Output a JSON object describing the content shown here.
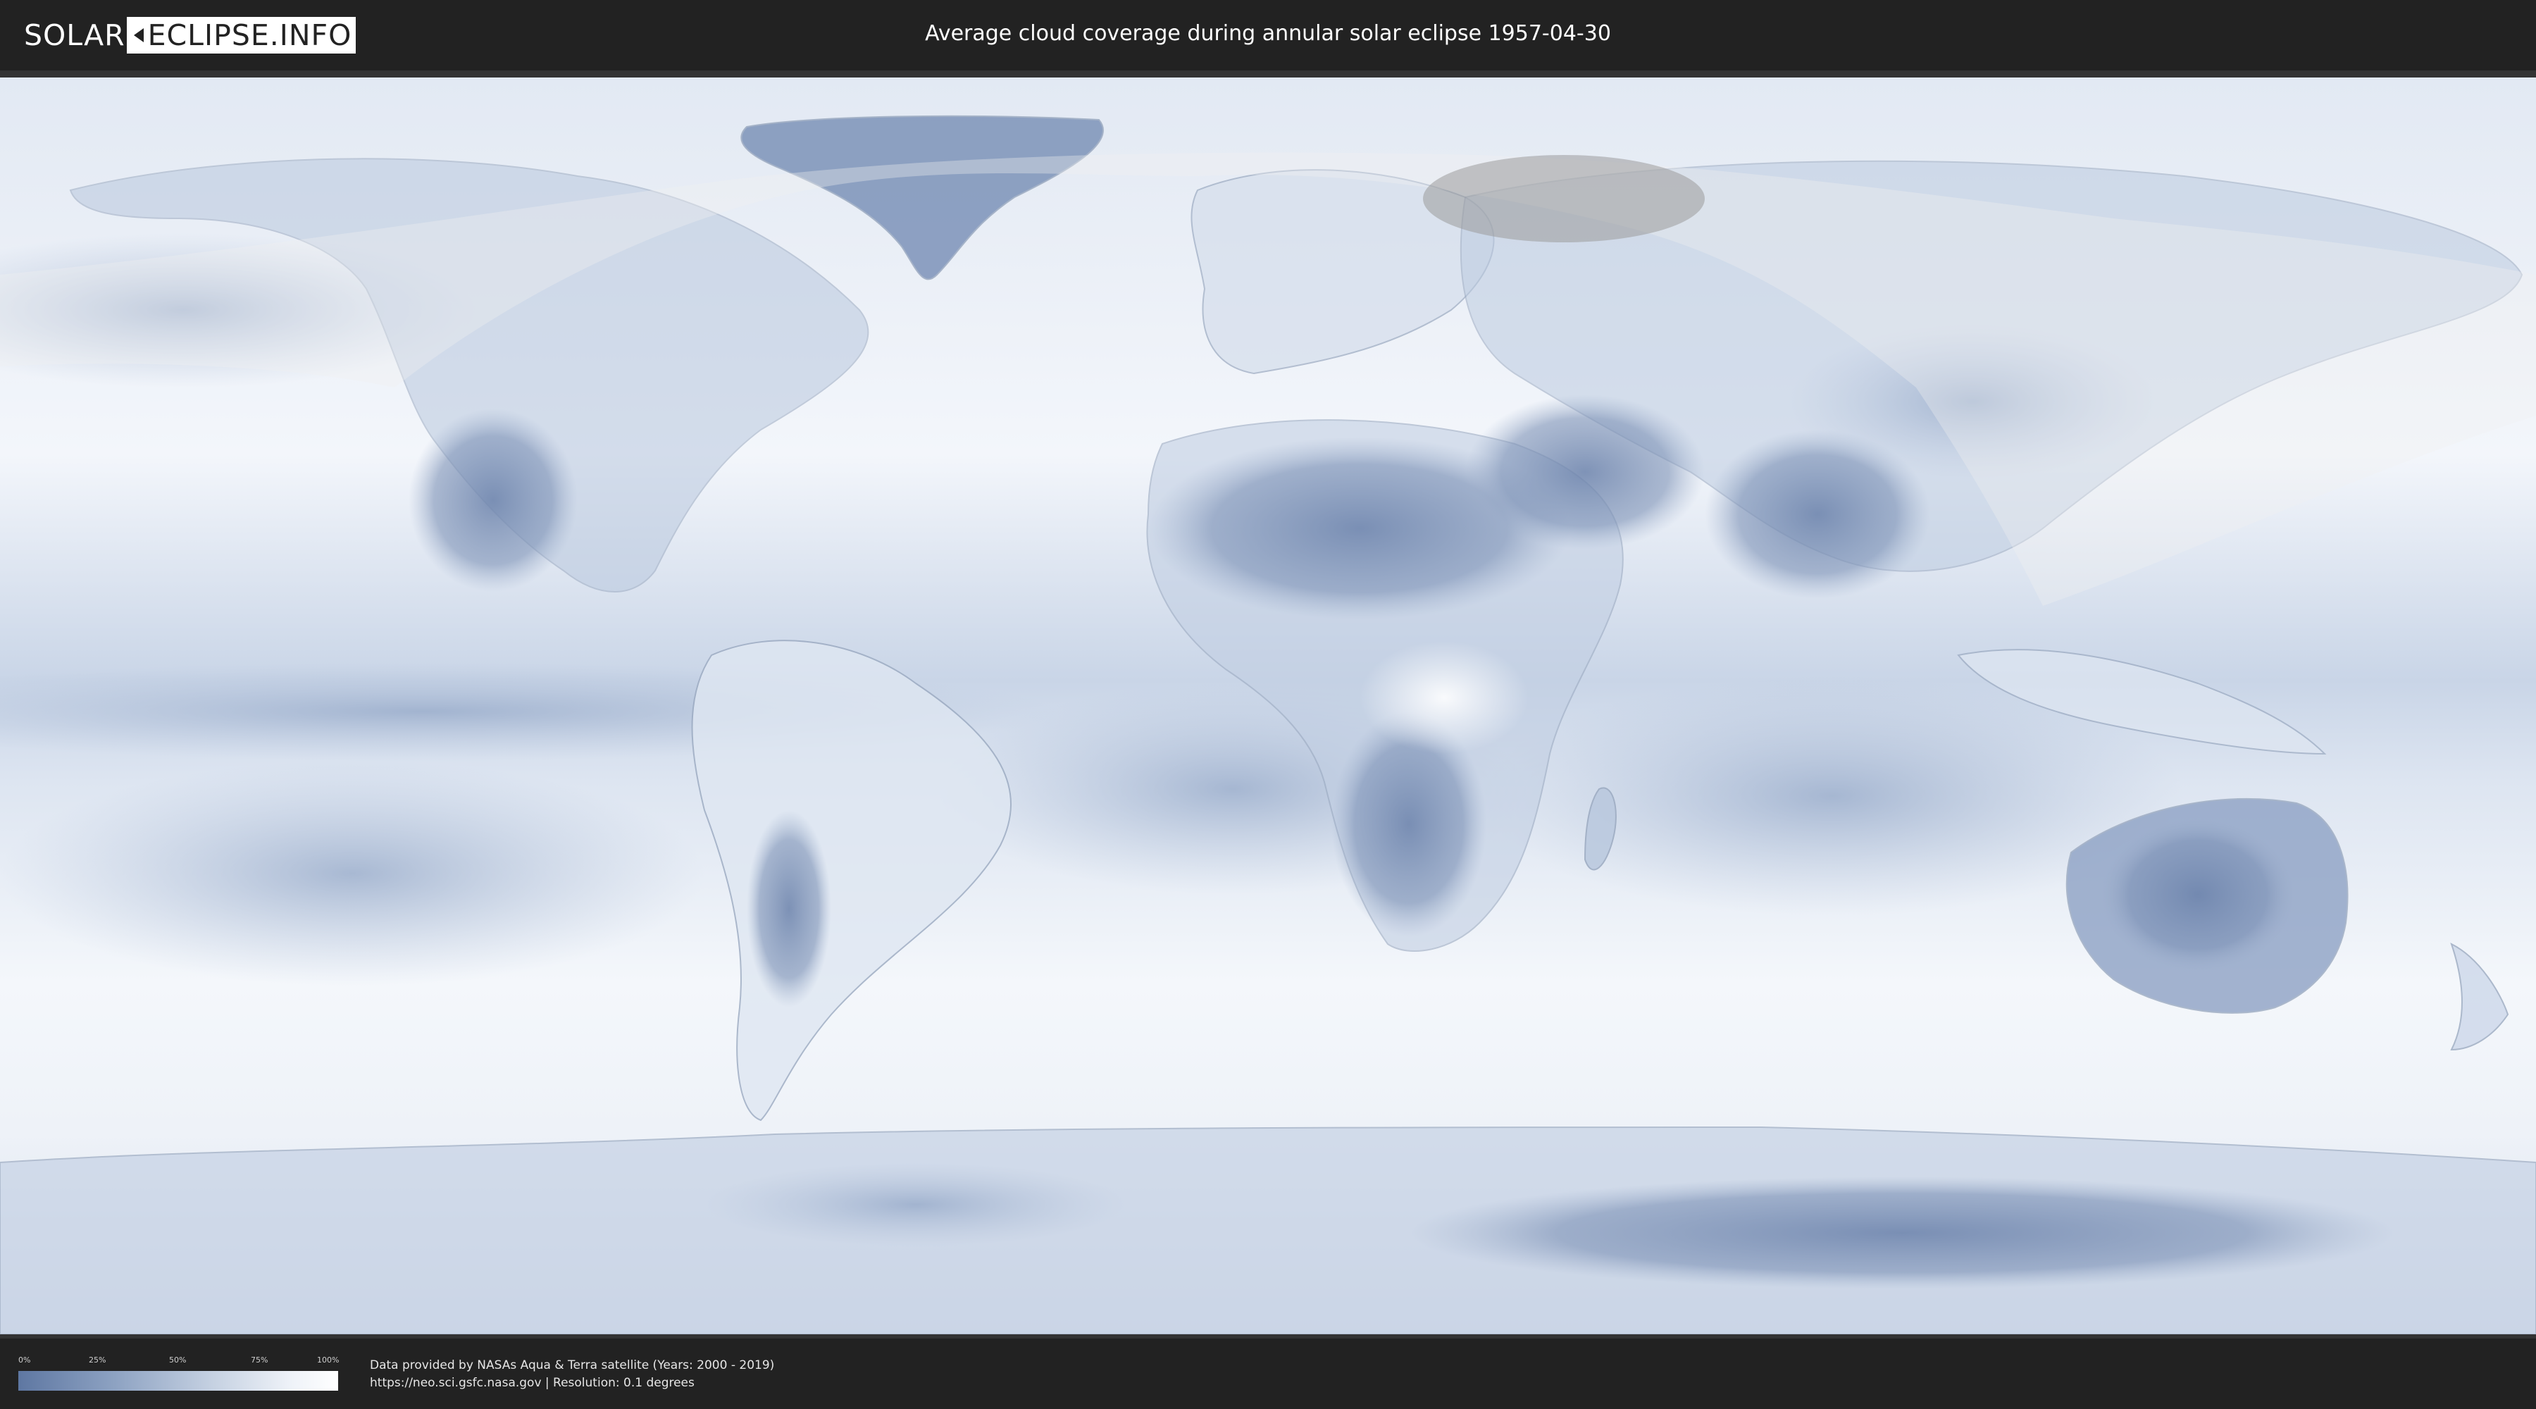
{
  "header": {
    "logo_left": "SOLAR",
    "logo_right": "ECLIPSE.INFO",
    "title": "Average cloud coverage during annular solar eclipse 1957-04-30"
  },
  "map": {
    "subject": "world cloud coverage map",
    "colors": {
      "low_coverage": "#5e77a2",
      "high_coverage": "#ffffff",
      "eclipse_visibility_shade": "#f2f2f2",
      "annular_path_shade": "#9a9a9a"
    }
  },
  "legend": {
    "ticks": [
      "0%",
      "25%",
      "50%",
      "75%",
      "100%"
    ]
  },
  "footer": {
    "credit_line_1": "Data provided by NASAs Aqua & Terra satellite (Years: 2000 - 2019)",
    "credit_line_2": "https://neo.sci.gsfc.nasa.gov | Resolution: 0.1 degrees"
  }
}
